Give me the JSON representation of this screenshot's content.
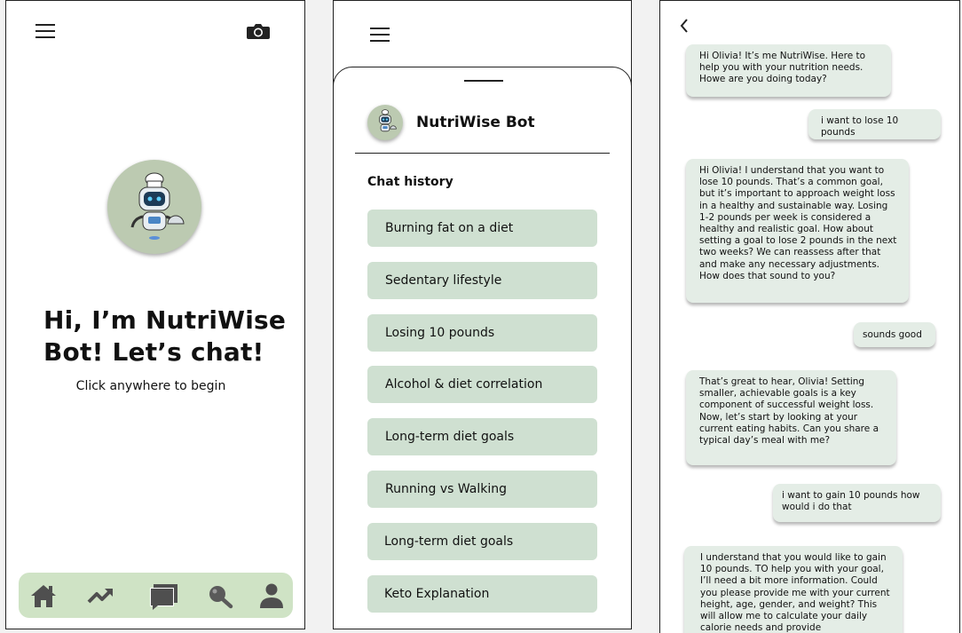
{
  "screen1": {
    "title_line1": "Hi, I’m NutriWise",
    "title_line2": "Bot! Let’s chat!",
    "subtitle": "Click anywhere to begin",
    "nav_icons": [
      "home-icon",
      "trending-icon",
      "chat-icon",
      "search-icon",
      "profile-icon"
    ]
  },
  "screen2": {
    "bot_name": "NutriWise Bot",
    "history_title": "Chat history",
    "history": [
      "Burning fat on a diet",
      "Sedentary lifestyle",
      "Losing 10 pounds",
      "Alcohol & diet correlation",
      "Long-term diet goals",
      "Running vs Walking",
      "Long-term diet goals",
      "Keto Explanation"
    ]
  },
  "screen3": {
    "messages": [
      {
        "from": "bot",
        "text": "Hi Olivia! It’s me NutriWise. Here to help you with your nutrition needs. Howe are you doing today?"
      },
      {
        "from": "user",
        "text": "i want to lose 10 pounds"
      },
      {
        "from": "bot",
        "text": "Hi Olivia! I understand that you want to lose 10 pounds. That’s a common goal, but it’s important to approach weight loss in a healthy and sustainable way. Losing 1-2 pounds per week is considered a healthy and realistic goal. How about setting a goal to lose 2 pounds in the next  two weeks? We can reassess after that and make any necessary adjustments. How does that sound to you?"
      },
      {
        "from": "user",
        "text": "sounds good"
      },
      {
        "from": "bot",
        "text": "That’s great to hear, Olivia! Setting smaller, achievable goals is a key component of successful weight loss. Now, let’s start by looking at your current eating habits. Can you share a typical day’s meal with me?"
      },
      {
        "from": "user",
        "text": "i want to gain 10 pounds how would i do that"
      },
      {
        "from": "bot",
        "text": "I understand that you would like to gain 10 pounds. TO help you with your goal, I’ll need a bit more information. Could you please provide me with your current height, age, gender, and weight? This will allow me to calculate your daily calorie needs and provide"
      }
    ]
  },
  "colors": {
    "nav_bg": "#cfe3c5",
    "history_item_bg": "#cfe0d1",
    "bubble_bg": "#e4ede6",
    "avatar_bg": "#bccab1"
  }
}
